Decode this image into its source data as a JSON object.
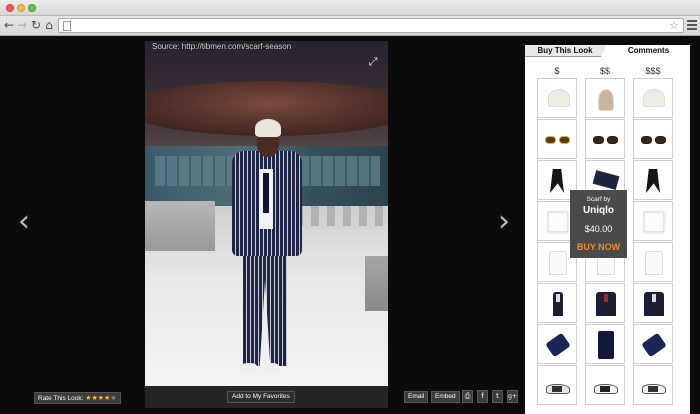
{
  "photo": {
    "source_label": "Source: http://tibmen.com/scarf-season"
  },
  "actions": {
    "rate_label": "Rate This Look:",
    "rating": 4,
    "rating_max": 5,
    "favorites_label": "Add to My Favorites",
    "email_label": "Email",
    "embed_label": "Embed",
    "share_icons": [
      "print-icon",
      "facebook-icon",
      "twitter-icon",
      "googleplus-icon"
    ]
  },
  "panel": {
    "tabs": [
      {
        "label": "Buy This Look",
        "active": true
      },
      {
        "label": "Comments",
        "active": false
      }
    ],
    "price_tiers": [
      "$",
      "$$",
      "$$$"
    ],
    "rows": [
      {
        "category": "hat"
      },
      {
        "category": "sunglasses"
      },
      {
        "category": "scarf"
      },
      {
        "category": "pocket-square"
      },
      {
        "category": "shirt"
      },
      {
        "category": "suit"
      },
      {
        "category": "tie"
      },
      {
        "category": "shoes"
      }
    ],
    "tooltip": {
      "by_label": "Scarf by",
      "brand": "Uniqlo",
      "price": "$40.00",
      "buy_label": "BUY NOW"
    }
  },
  "colors": {
    "accent_buy": "#f08a24",
    "star": "#f4c21b",
    "background": "#0b0b0b"
  }
}
